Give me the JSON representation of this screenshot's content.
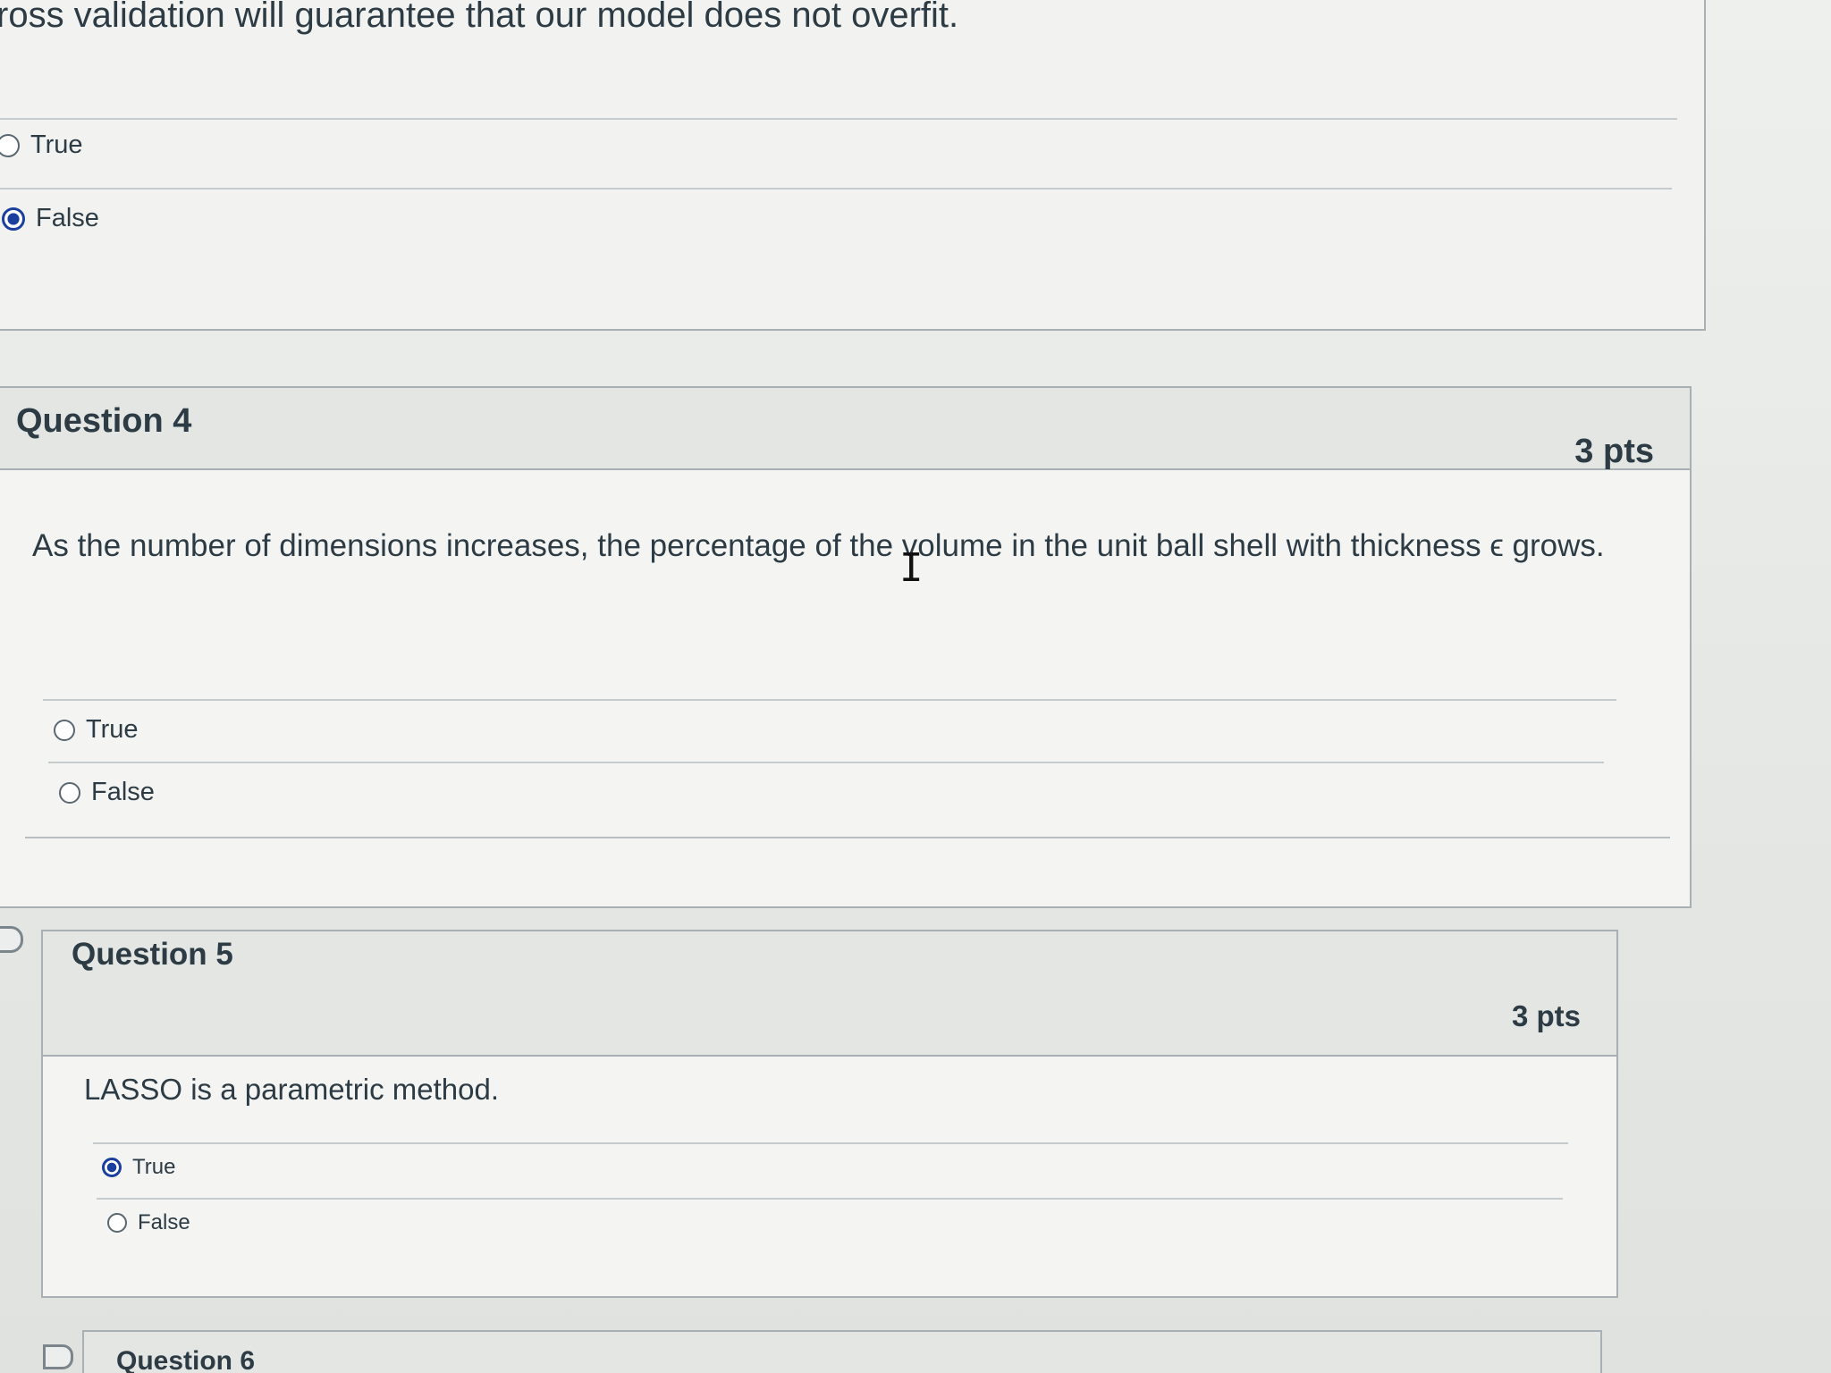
{
  "prev_question": {
    "text": "ross validation will guarantee that our model does not overfit.",
    "answers": [
      {
        "label": "True",
        "selected": false
      },
      {
        "label": "False",
        "selected": true
      }
    ]
  },
  "question4": {
    "title": "Question 4",
    "points": "3 pts",
    "text": "As the number of dimensions increases, the percentage of the volume in the unit ball shell with thickness ϵ grows.",
    "answers": [
      {
        "label": "True",
        "selected": false
      },
      {
        "label": "False",
        "selected": false
      }
    ]
  },
  "question5": {
    "title": "Question 5",
    "points": "3 pts",
    "text": "LASSO is a parametric method.",
    "answers": [
      {
        "label": "True",
        "selected": true
      },
      {
        "label": "False",
        "selected": false
      }
    ]
  },
  "question6": {
    "title": "Question 6"
  },
  "colors": {
    "selected_radio": "#1a3f9e",
    "text": "#2d3b45",
    "border": "#a9b0b3"
  }
}
